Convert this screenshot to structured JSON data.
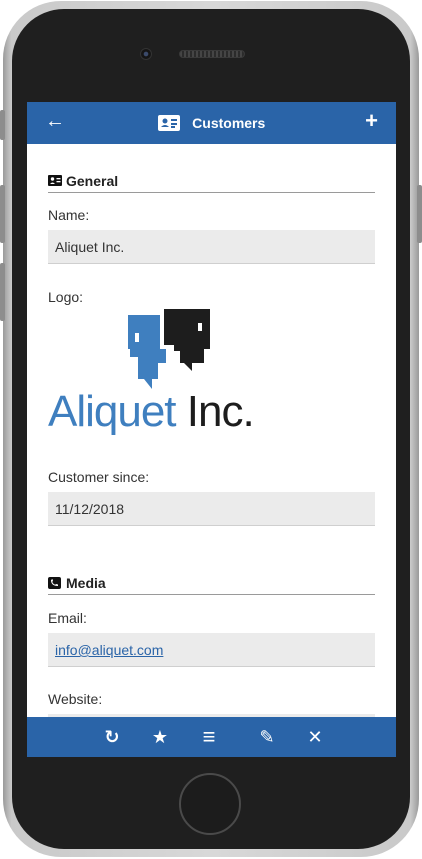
{
  "header": {
    "title": "Customers",
    "back_icon": "arrow-left-icon",
    "add_icon": "plus-icon",
    "back_glyph": "←",
    "add_glyph": "+"
  },
  "sections": {
    "general": {
      "title": "General",
      "icon": "id-card-icon",
      "name_label": "Name:",
      "name_value": "Aliquet Inc.",
      "logo_label": "Logo:",
      "logo_text_part1": "Aliquet",
      "logo_text_part2": "Inc.",
      "customer_since_label": "Customer since:",
      "customer_since_value": "11/12/2018"
    },
    "media": {
      "title": "Media",
      "icon": "phone-icon",
      "email_label": "Email:",
      "email_value": "info@aliquet.com",
      "website_label": "Website:"
    }
  },
  "toolbar": {
    "refresh_glyph": "↻",
    "favorite_glyph": "★",
    "menu_glyph": "≡",
    "edit_glyph": "✎",
    "close_glyph": "✕"
  },
  "colors": {
    "accent": "#2a64a8",
    "field_bg": "#ebebeb",
    "logo_blue": "#3f7fbf",
    "logo_dark": "#1d1d1d"
  }
}
